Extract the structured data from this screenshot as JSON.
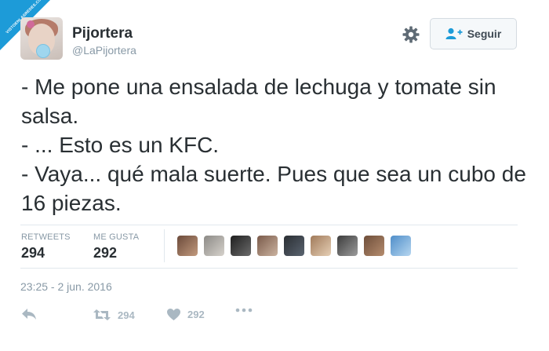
{
  "watermark": {
    "text": "VISTOENLASREDES.COM"
  },
  "profile": {
    "name": "Pijortera",
    "handle": "@LaPijortera",
    "avatar_icon": "profile-avatar"
  },
  "header": {
    "settings_icon": "gear-icon",
    "follow_icon": "add-user-icon",
    "follow_label": "Seguir"
  },
  "tweet": {
    "text": "- Me pone una ensalada de lechuga y tomate sin salsa.\n- ... Esto es un KFC.\n- Vaya... qué mala suerte. Pues que sea un cubo de 16 piezas."
  },
  "stats": {
    "retweets_label": "RETWEETS",
    "retweets_value": "294",
    "likes_label": "ME GUSTA",
    "likes_value": "292",
    "likers_count": 9
  },
  "timestamp": "23:25 - 2 jun. 2016",
  "actions": {
    "reply_icon": "reply-icon",
    "retweet_icon": "retweet-icon",
    "retweet_count": "294",
    "like_icon": "heart-icon",
    "like_count": "292",
    "more_icon": "more-icon"
  },
  "colors": {
    "text": "#292f33",
    "muted": "#8899a6",
    "action": "#aab8c2",
    "accent": "#1d9bd8"
  }
}
